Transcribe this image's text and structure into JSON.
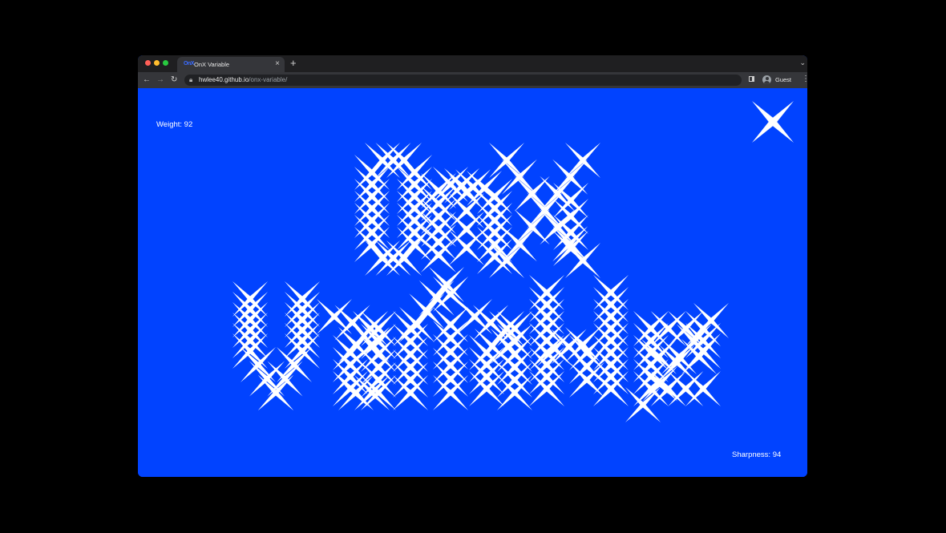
{
  "browser": {
    "tab": {
      "favicon": "OnX",
      "title": "OnX Variable",
      "close_icon": "close-icon"
    },
    "new_tab_icon": "plus-icon",
    "tab_menu_icon": "chevron-down-icon",
    "nav": {
      "back_icon": "arrow-left-icon",
      "forward_icon": "arrow-right-icon",
      "reload_icon": "reload-icon"
    },
    "address": {
      "host": "hwlee40.github.io",
      "path": "/onx-variable/"
    },
    "profile_label": "Guest"
  },
  "page": {
    "weight_label": "Weight: 92",
    "sharpness_label": "Sharpness: 94",
    "background_color": "#0143ff",
    "glyph_color": "#ffffff"
  }
}
